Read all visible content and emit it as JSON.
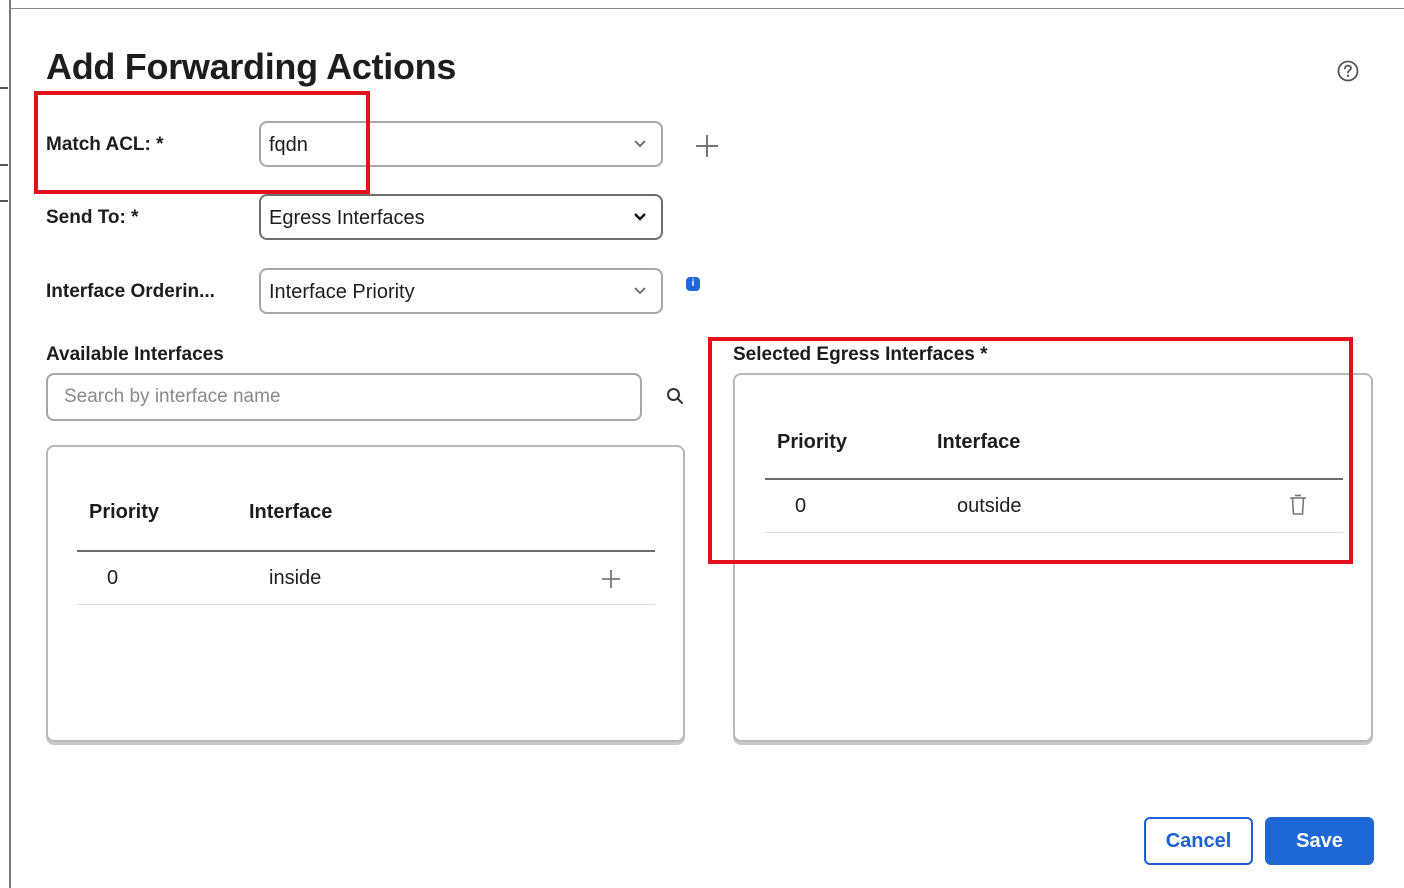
{
  "dialog": {
    "title": "Add Forwarding Actions",
    "help_icon": "question-circle-icon"
  },
  "form": {
    "match_acl": {
      "label": "Match ACL: *",
      "value": "fqdn"
    },
    "send_to": {
      "label": "Send To: *",
      "value": "Egress Interfaces"
    },
    "interface_ordering": {
      "label": "Interface Orderin...",
      "value": "Interface Priority"
    },
    "info_icon": "info-icon",
    "add_icon": "plus-icon"
  },
  "available": {
    "label": "Available Interfaces",
    "search_placeholder": "Search by interface name",
    "columns": [
      "Priority",
      "Interface"
    ],
    "rows": [
      {
        "priority": "0",
        "interface": "inside"
      }
    ]
  },
  "selected": {
    "label": "Selected Egress Interfaces *",
    "columns": [
      "Priority",
      "Interface"
    ],
    "rows": [
      {
        "priority": "0",
        "interface": "outside"
      }
    ]
  },
  "footer": {
    "cancel_label": "Cancel",
    "save_label": "Save"
  },
  "colors": {
    "primary": "#1f66d6",
    "highlight": "#e3111a"
  }
}
